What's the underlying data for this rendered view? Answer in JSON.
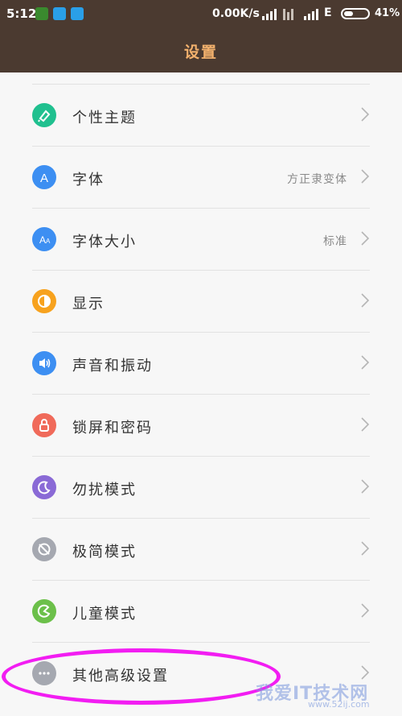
{
  "status_bar": {
    "time": "5:12",
    "network_speed": "0.00K/s",
    "network_type": "E",
    "battery_percent": "41%",
    "battery_level": 0.41
  },
  "header": {
    "title": "设置"
  },
  "settings_items": [
    {
      "label": "个性主题",
      "value": "",
      "icon": "theme-brush-icon",
      "color": "#20c08f"
    },
    {
      "label": "字体",
      "value": "方正隶变体",
      "icon": "font-a-icon",
      "color": "#3d8ff2"
    },
    {
      "label": "字体大小",
      "value": "标准",
      "icon": "font-size-icon",
      "color": "#3d8ff2"
    },
    {
      "label": "显示",
      "value": "",
      "icon": "display-brightness-icon",
      "color": "#f7a21e"
    },
    {
      "label": "声音和振动",
      "value": "",
      "icon": "speaker-icon",
      "color": "#3d8ff2"
    },
    {
      "label": "锁屏和密码",
      "value": "",
      "icon": "lock-icon",
      "color": "#f06a5a"
    },
    {
      "label": "勿扰模式",
      "value": "",
      "icon": "moon-icon",
      "color": "#8a6ad6"
    },
    {
      "label": "极简模式",
      "value": "",
      "icon": "minimal-mode-icon",
      "color": "#a5a8b0"
    },
    {
      "label": "儿童模式",
      "value": "",
      "icon": "child-mode-icon",
      "color": "#6cc04a"
    },
    {
      "label": "其他高级设置",
      "value": "",
      "icon": "more-dots-icon",
      "color": "#a5a8b0"
    }
  ],
  "watermark": {
    "text": "我爱IT技术网",
    "url": "www.52ij.com"
  },
  "colors": {
    "header_bg": "#4b3a30",
    "title": "#f3b16d",
    "highlight": "#f21df2"
  }
}
